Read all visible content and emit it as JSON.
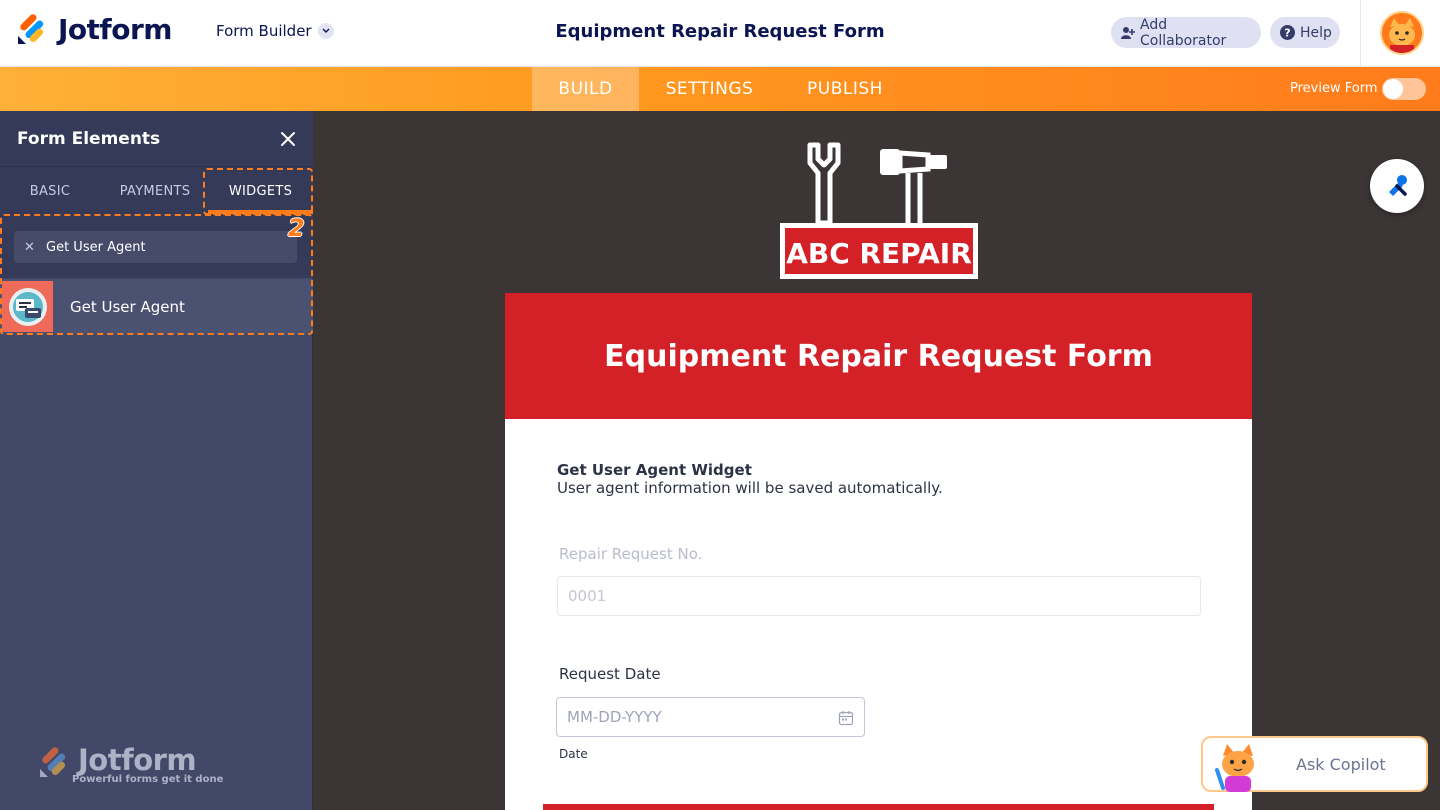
{
  "header": {
    "brand": "Jotform",
    "builder_dropdown": "Form Builder",
    "title": "Equipment Repair Request Form",
    "add_collaborator": "Add Collaborator",
    "help": "Help"
  },
  "nav": {
    "tabs": [
      "BUILD",
      "SETTINGS",
      "PUBLISH"
    ],
    "active_tab": "BUILD",
    "preview_label": "Preview Form",
    "preview_on": false
  },
  "sidebar": {
    "title": "Form Elements",
    "tabs": [
      "BASIC",
      "PAYMENTS",
      "WIDGETS"
    ],
    "active_tab": "WIDGETS",
    "step_marker": "2",
    "search_value": "Get User Agent",
    "results": [
      {
        "label": "Get User Agent"
      }
    ],
    "footer_brand": "Jotform",
    "footer_tagline": "Powerful forms get it done"
  },
  "form": {
    "logo_text": "ABC REPAIR",
    "title": "Equipment Repair Request Form",
    "widget_title": "Get User Agent Widget",
    "widget_desc": "User agent information will be saved automatically.",
    "fields": {
      "request_no_label": "Repair Request No.",
      "request_no_value": "0001",
      "date_label": "Request Date",
      "date_placeholder": "MM-DD-YYYY",
      "date_sublabel": "Date"
    }
  },
  "copilot": {
    "label": "Ask Copilot"
  },
  "colors": {
    "accent_orange": "#ff7b1c",
    "brand_navy": "#0a1551",
    "form_red": "#d42127",
    "sidebar_bg": "#424867"
  }
}
